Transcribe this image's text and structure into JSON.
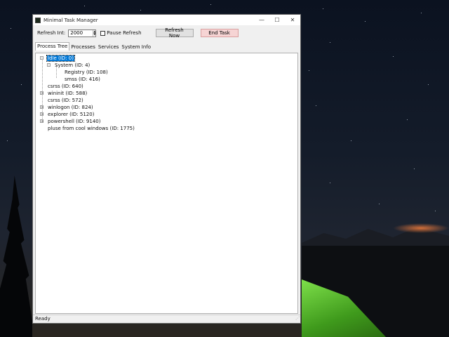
{
  "window": {
    "title": "Minimal Task Manager",
    "controls": {
      "minimize": "—",
      "maximize": "☐",
      "close": "✕"
    }
  },
  "toolbar": {
    "refresh_label": "Refresh Int:",
    "refresh_value": "2000",
    "pause_label": "Pause Refresh",
    "refresh_now_label": "Refresh Now",
    "end_task_label": "End Task"
  },
  "tabs": [
    {
      "label": "Process Tree",
      "active": true
    },
    {
      "label": "Processes",
      "active": false
    },
    {
      "label": "Services",
      "active": false
    },
    {
      "label": "System Info",
      "active": false
    }
  ],
  "tree": [
    {
      "label": "Idle (ID: 0)",
      "level": 0,
      "expander": "-",
      "selected": true
    },
    {
      "label": "System (ID: 4)",
      "level": 1,
      "expander": "-",
      "selected": false
    },
    {
      "label": "Registry (ID: 108)",
      "level": 2,
      "expander": "",
      "selected": false
    },
    {
      "label": "smss (ID: 416)",
      "level": 2,
      "expander": "",
      "selected": false
    },
    {
      "label": "csrss (ID: 640)",
      "level": 0,
      "expander": "",
      "selected": false
    },
    {
      "label": "wininit (ID: 588)",
      "level": 0,
      "expander": "+",
      "selected": false
    },
    {
      "label": "csrss (ID: 572)",
      "level": 0,
      "expander": "",
      "selected": false
    },
    {
      "label": "winlogon (ID: 824)",
      "level": 0,
      "expander": "+",
      "selected": false
    },
    {
      "label": "explorer (ID: 5120)",
      "level": 0,
      "expander": "+",
      "selected": false
    },
    {
      "label": "powershell (ID: 9140)",
      "level": 0,
      "expander": "+",
      "selected": false
    },
    {
      "label": "pluse from cool windows (ID: 1775)",
      "level": 0,
      "expander": "",
      "selected": false
    }
  ],
  "status": {
    "text": "Ready"
  }
}
